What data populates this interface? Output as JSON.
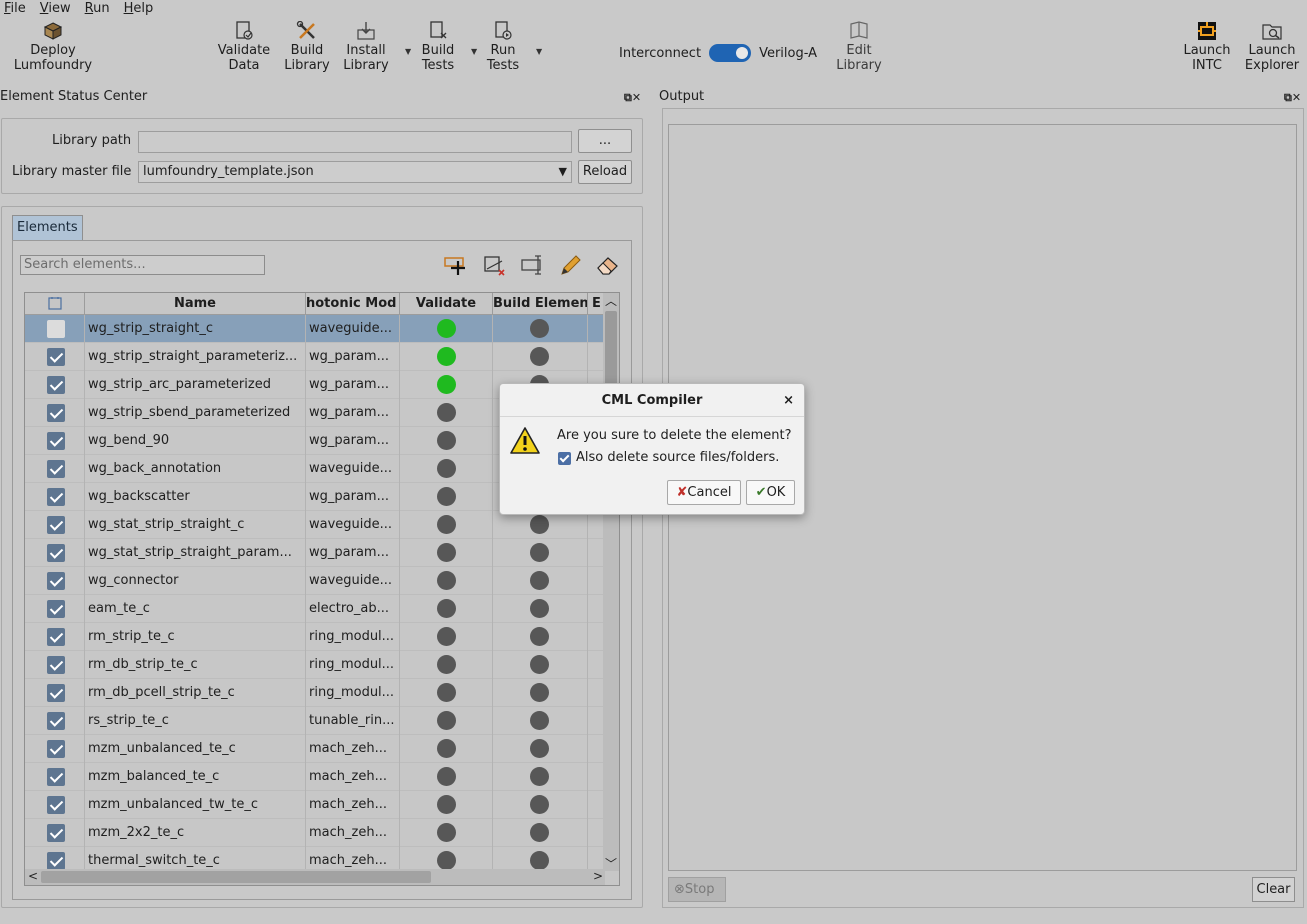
{
  "menu": [
    {
      "label": "File",
      "key": "F",
      "rest": "ile"
    },
    {
      "label": "View",
      "key": "V",
      "rest": "iew"
    },
    {
      "label": "Run",
      "key": "R",
      "rest": "un"
    },
    {
      "label": "Help",
      "key": "H",
      "rest": "elp"
    }
  ],
  "toolbar": {
    "deploy": "Deploy\nLumfoundry",
    "validate": "Validate\nData",
    "build_library": "Build\nLibrary",
    "install_library": "Install\nLibrary",
    "build_tests": "Build\nTests",
    "run_tests": "Run\nTests",
    "toggle_left": "Interconnect",
    "toggle_right": "Verilog-A",
    "edit_library": "Edit\nLibrary",
    "launch_intc": "Launch\nINTC",
    "launch_explorer": "Launch\nExplorer"
  },
  "left_panel": {
    "title": "Element Status Center",
    "library_path_label": "Library path",
    "library_path_value": "",
    "browse_button": "...",
    "master_file_label": "Library master file",
    "master_file_value": "lumfoundry_template.json",
    "reload_button": "Reload",
    "tab_label": "Elements",
    "search_placeholder": "Search elements...",
    "columns": [
      "Name",
      "hotonic Mod",
      "Validate",
      "Build Elemen",
      "E"
    ],
    "rows": [
      {
        "name": "wg_strip_straight_c",
        "model": "waveguide...",
        "checked": false,
        "validate": "green",
        "selected": true
      },
      {
        "name": "wg_strip_straight_parameteriz...",
        "model": "wg_param...",
        "checked": true,
        "validate": "green"
      },
      {
        "name": "wg_strip_arc_parameterized",
        "model": "wg_param...",
        "checked": true,
        "validate": "green"
      },
      {
        "name": "wg_strip_sbend_parameterized",
        "model": "wg_param...",
        "checked": true,
        "validate": "gray"
      },
      {
        "name": "wg_bend_90",
        "model": "wg_param...",
        "checked": true,
        "validate": "gray"
      },
      {
        "name": "wg_back_annotation",
        "model": "waveguide...",
        "checked": true,
        "validate": "gray"
      },
      {
        "name": "wg_backscatter",
        "model": "wg_param...",
        "checked": true,
        "validate": "gray"
      },
      {
        "name": "wg_stat_strip_straight_c",
        "model": "waveguide...",
        "checked": true,
        "validate": "gray"
      },
      {
        "name": "wg_stat_strip_straight_param...",
        "model": "wg_param...",
        "checked": true,
        "validate": "gray"
      },
      {
        "name": "wg_connector",
        "model": "waveguide...",
        "checked": true,
        "validate": "gray"
      },
      {
        "name": "eam_te_c",
        "model": "electro_ab...",
        "checked": true,
        "validate": "gray"
      },
      {
        "name": "rm_strip_te_c",
        "model": "ring_modul...",
        "checked": true,
        "validate": "gray"
      },
      {
        "name": "rm_db_strip_te_c",
        "model": "ring_modul...",
        "checked": true,
        "validate": "gray"
      },
      {
        "name": "rm_db_pcell_strip_te_c",
        "model": "ring_modul...",
        "checked": true,
        "validate": "gray"
      },
      {
        "name": "rs_strip_te_c",
        "model": "tunable_rin...",
        "checked": true,
        "validate": "gray"
      },
      {
        "name": "mzm_unbalanced_te_c",
        "model": "mach_zeh...",
        "checked": true,
        "validate": "gray"
      },
      {
        "name": "mzm_balanced_te_c",
        "model": "mach_zeh...",
        "checked": true,
        "validate": "gray"
      },
      {
        "name": "mzm_unbalanced_tw_te_c",
        "model": "mach_zeh...",
        "checked": true,
        "validate": "gray"
      },
      {
        "name": "mzm_2x2_te_c",
        "model": "mach_zeh...",
        "checked": true,
        "validate": "gray"
      },
      {
        "name": "thermal_switch_te_c",
        "model": "mach_zeh...",
        "checked": true,
        "validate": "gray"
      }
    ]
  },
  "right_panel": {
    "title": "Output",
    "stop_button": "Stop",
    "clear_button": "Clear"
  },
  "dialog": {
    "title": "CML Compiler",
    "close": "×",
    "message": "Are you sure to delete the element?",
    "checkbox_label": "Also delete source files/folders.",
    "cancel": "Cancel",
    "ok": "OK"
  },
  "colors": {
    "accent": "#1f64b3",
    "status_green": "#1fba1f",
    "status_gray": "#575757"
  }
}
